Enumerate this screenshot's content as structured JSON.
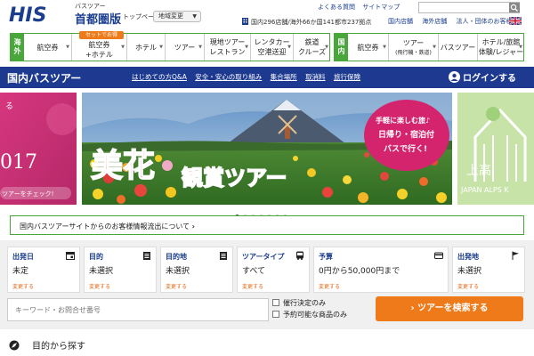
{
  "header": {
    "logo_text": "HIS",
    "site_sub": "バスツアー",
    "site_name": "首都圏版",
    "top_link": "トップページ",
    "region_button": "地域変更",
    "quick_links": [
      "よくある質問",
      "サイトマップ"
    ],
    "search_placeholder": "",
    "store_info": "国内296店舗/海外66か国141都市237拠点",
    "sub_links": [
      "国内店舗",
      "海外店舗",
      "法人・団体のお客様"
    ]
  },
  "nav_overseas": {
    "tag": "海外",
    "badge": "セットでお得",
    "items": [
      {
        "label": "航空券",
        "sub": ""
      },
      {
        "label": "航空券",
        "sub": "+ホテル"
      },
      {
        "label": "ホテル",
        "sub": ""
      },
      {
        "label": "ツアー",
        "sub": ""
      },
      {
        "label": "現地ツアー",
        "sub": "レストラン"
      },
      {
        "label": "レンタカー",
        "sub": "空港送迎"
      },
      {
        "label": "鉄道",
        "sub": "クルーズ"
      }
    ]
  },
  "nav_domestic": {
    "tag": "国内",
    "items": [
      {
        "label": "航空券",
        "sub": ""
      },
      {
        "label": "ツアー",
        "sub": "(飛行機・鉄道)"
      },
      {
        "label": "バスツアー",
        "sub": ""
      },
      {
        "label": "ホテル/旅館",
        "sub": "体験/レジャー"
      }
    ]
  },
  "bluebar": {
    "title": "国内バスツアー",
    "links": [
      "はじめての方Q&A",
      "安全・安心の取り組み",
      "集合場所",
      "取消料",
      "旅行保険"
    ],
    "login": "ログインする"
  },
  "carousel": {
    "left_text1": "017",
    "left_text2": "ツアーをチェック!",
    "main_title1": "美花",
    "main_title2": "観賞ツアー",
    "bubble1": "手軽に楽しむ旅♪",
    "bubble2": "日帰り・宿泊付",
    "bubble3": "バスで行く!",
    "right_text1": "上高",
    "right_text2": "JAPAN ALPS K",
    "dots_count": 7,
    "active_dot": 1
  },
  "notice": "国内バスツアーサイトからのお客様情報流出について",
  "filters": [
    {
      "label": "出発日",
      "value": "未定",
      "change": "変更する",
      "icon": "calendar-icon"
    },
    {
      "label": "目的",
      "value": "未選択",
      "change": "変更する",
      "icon": "clipboard-icon"
    },
    {
      "label": "目的地",
      "value": "未選択",
      "change": "変更する",
      "icon": "clipboard-icon"
    },
    {
      "label": "ツアータイプ",
      "value": "すべて",
      "change": "変更する",
      "icon": "bus-icon"
    },
    {
      "label": "予算",
      "value": "0円から50,000円まで",
      "change": "変更する",
      "icon": "card-icon"
    },
    {
      "label": "出発地",
      "value": "未選択",
      "change": "変更する",
      "icon": "flag-icon"
    }
  ],
  "keyword_placeholder": "キーワード・お問合せ番号",
  "checkboxes": [
    "催行決定のみ",
    "予約可能な商品のみ"
  ],
  "search_button": "ツアーを検索する",
  "section_title": "目的から探す",
  "colors": {
    "navy": "#1d3a90",
    "green": "#49a63b",
    "orange": "#ee7a1a",
    "magenta": "#d4246e"
  }
}
